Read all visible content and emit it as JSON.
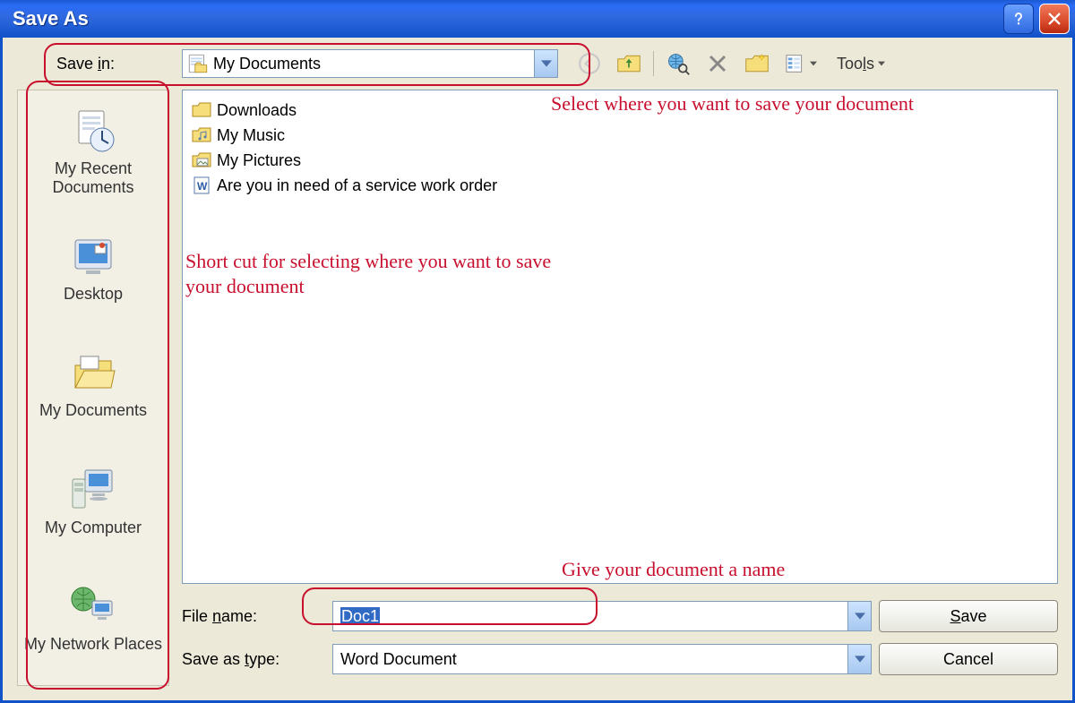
{
  "window": {
    "title": "Save As"
  },
  "savein": {
    "label": "Save in:",
    "value": "My Documents"
  },
  "toolbar": {
    "tools_label": "Tools"
  },
  "places": [
    {
      "label": "My Recent Documents"
    },
    {
      "label": "Desktop"
    },
    {
      "label": "My Documents"
    },
    {
      "label": "My Computer"
    },
    {
      "label": "My Network Places"
    }
  ],
  "files": [
    {
      "name": "Downloads",
      "kind": "folder"
    },
    {
      "name": "My Music",
      "kind": "folder-special"
    },
    {
      "name": "My Pictures",
      "kind": "folder-special"
    },
    {
      "name": "Are you in need of a service work order",
      "kind": "word-doc"
    }
  ],
  "filename": {
    "label": "File name:",
    "value": "Doc1"
  },
  "savetype": {
    "label": "Save as type:",
    "value": "Word Document"
  },
  "buttons": {
    "save": "Save",
    "cancel": "Cancel"
  },
  "annotations": {
    "select_where": "Select where you want to save your document",
    "short_cut": "Short cut for selecting where you want to save your document",
    "give_name": "Give your document a name"
  }
}
